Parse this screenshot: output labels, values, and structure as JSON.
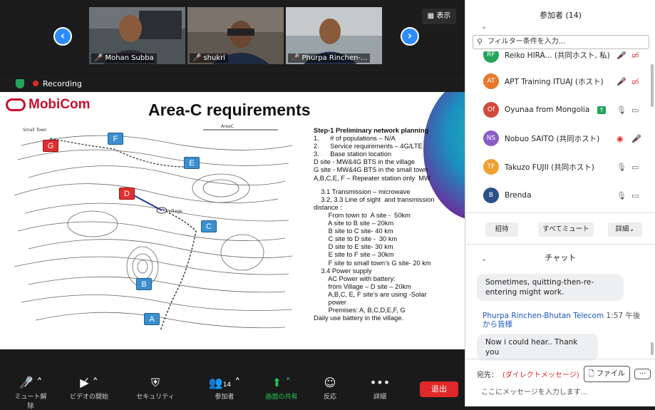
{
  "video": {
    "participants": [
      {
        "name": "Mohan Subba",
        "muted": true
      },
      {
        "name": "shukri",
        "muted": true
      },
      {
        "name": "Phurpa Rinchen-...",
        "muted": true
      }
    ],
    "view_button": "表示",
    "recording_label": "Recording"
  },
  "slide": {
    "logo": "MobiCom",
    "title": "Area-C requirements",
    "map_labels": {
      "small_town": "Small Town",
      "area": "AreaC",
      "village": "village"
    },
    "sites": [
      "G",
      "F",
      "E",
      "D",
      "C",
      "B",
      "A"
    ],
    "lines": [
      {
        "text": "Step-1 Preliminary network planning",
        "bold": true
      },
      {
        "text": "1.      # of populations – N/A"
      },
      {
        "text": "2.      Service requirements – 4G/LTE"
      },
      {
        "text": "3.      Base station location"
      },
      {
        "text": "D site - MW&4G BTS in the village"
      },
      {
        "text": "G site - MW&4G BTS in the small town"
      },
      {
        "text": "A,B,C,E, F – Repeater station only  MW"
      },
      {
        "text": ""
      },
      {
        "text": "    3.1 Transmission – microwave"
      },
      {
        "text": "    3.2, 3.3 Line of sight  and transmission"
      },
      {
        "text": "distance :"
      },
      {
        "text": "        From town to  A site -  50km"
      },
      {
        "text": "        A site to B site – 20km"
      },
      {
        "text": "        B site to C site- 40 km"
      },
      {
        "text": "        C site to D site -  30 km"
      },
      {
        "text": "        D site to E site- 30 km"
      },
      {
        "text": "        E site to F site – 30km"
      },
      {
        "text": "        F site to small town’s G site- 20 km"
      },
      {
        "text": "    3.4 Power supply"
      },
      {
        "text": "        AC Power with battery:"
      },
      {
        "text": "        from Village – D site – 20km"
      },
      {
        "text": "        A,B,C, E, F site’s are using -Solar"
      },
      {
        "text": "        power"
      },
      {
        "text": "        Premises: A, B,C,D,E,F, G"
      },
      {
        "text": "Daily use battery in the village."
      }
    ]
  },
  "toolbar": {
    "mute": "ミュート解除",
    "video": "ビデオの開始",
    "security": "セキュリティ",
    "participants": "参加者",
    "participants_count": "14",
    "share": "画面の共有",
    "reactions": "反応",
    "more": "詳細",
    "leave": "退出"
  },
  "panel": {
    "title": "参加者 (14)",
    "filter_placeholder": "フィルター条件を入力...",
    "participants": [
      {
        "initials": "RF",
        "name": "Reiko HIRA... (共同ホスト, 私)",
        "color": "#23a55a"
      },
      {
        "initials": "AT",
        "name": "APT Training ITUAJ (ホスト)",
        "color": "#e8782a"
      },
      {
        "initials": "Of",
        "name": "Oyunaa from Mongolia",
        "color": "#d24a3a"
      },
      {
        "initials": "NS",
        "name": "Nobuo SAITO (共同ホスト)",
        "color": "#8a5cc8"
      },
      {
        "initials": "TF",
        "name": "Takuzo FUJII (共同ホスト)",
        "color": "#f0a030"
      },
      {
        "initials": "B",
        "name": "Brenda",
        "color": "#2d4f8a"
      }
    ],
    "invite": "招待",
    "mute_all": "すべてミュート",
    "details": "詳細⌄",
    "chat_title": "チャット",
    "chat": [
      {
        "text": "Sometimes, quitting-then-re-entering might work."
      },
      {
        "sender": "Phurpa Rinchen-Bhutan Telecom",
        "time": "1:57 午後",
        "to": "から皆様"
      },
      {
        "text": "Now i could hear.. Thank you"
      }
    ],
    "to_label": "宛先：",
    "to_target": "(ダイレクトメッセージ)",
    "file_button": "ファイル",
    "message_placeholder": "ここにメッセージを入力します..."
  }
}
